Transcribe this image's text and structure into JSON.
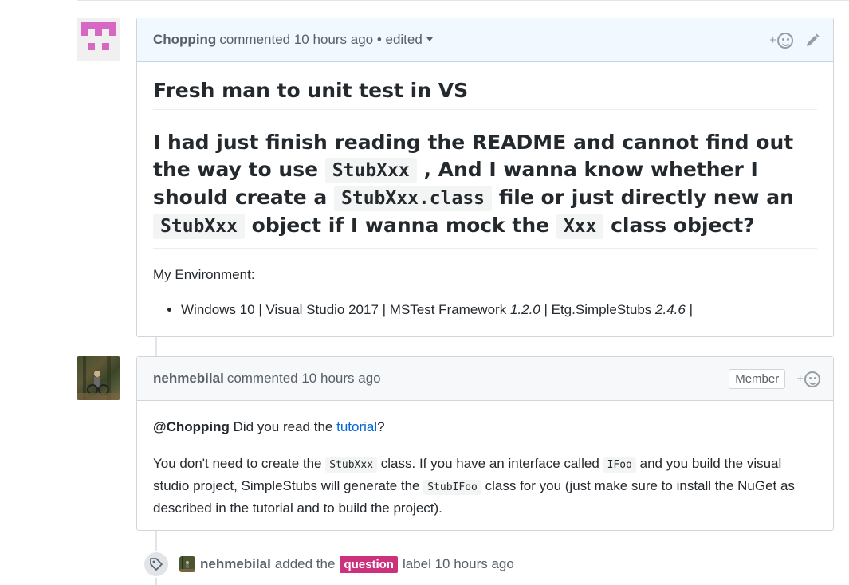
{
  "comments": [
    {
      "author": "Chopping",
      "header_text": "commented 10 hours ago • edited",
      "title": "Fresh man to unit test in VS",
      "question": {
        "t1": "I had just finish reading the README and cannot find out the way to use",
        "c1": "StubXxx",
        "t2": ", And I wanna know whether I should create a",
        "c2": "StubXxx.class",
        "t3": "file or just directly new an",
        "c3": "StubXxx",
        "t4": "object if I wanna mock the",
        "c4": "Xxx",
        "t5": "class object?"
      },
      "env_label": "My Environment:",
      "env_item": {
        "a": "Windows 10 | Visual Studio 2017 | MSTest Framework",
        "v1": "1.2.0",
        "b": "| Etg.SimpleStubs",
        "v2": "2.4.6",
        "c": "|"
      }
    },
    {
      "author": "nehmebilal",
      "header_text": "commented 10 hours ago",
      "badge": "Member",
      "p1": {
        "mention": "@Chopping",
        "t1": "Did you read the",
        "link": "tutorial",
        "t2": "?"
      },
      "p2": {
        "t1": "You don't need to create the",
        "c1": "StubXxx",
        "t2": "class. If you have an interface called",
        "c2": "IFoo",
        "t3": "and you build the visual studio project, SimpleStubs will generate the",
        "c3": "StubIFoo",
        "t4": "class for you (just make sure to install the NuGet as described in the tutorial and to build the project)."
      }
    }
  ],
  "event": {
    "actor": "nehmebilal",
    "action": "added the",
    "label": "question",
    "suffix": "label 10 hours ago"
  },
  "reaction_plus": "+",
  "colors": {
    "label": "#cc317c",
    "link": "#0366d6",
    "header_blue": "#f1f8ff"
  },
  "icons": [
    "smiley-icon",
    "pencil-icon",
    "tag-icon"
  ]
}
